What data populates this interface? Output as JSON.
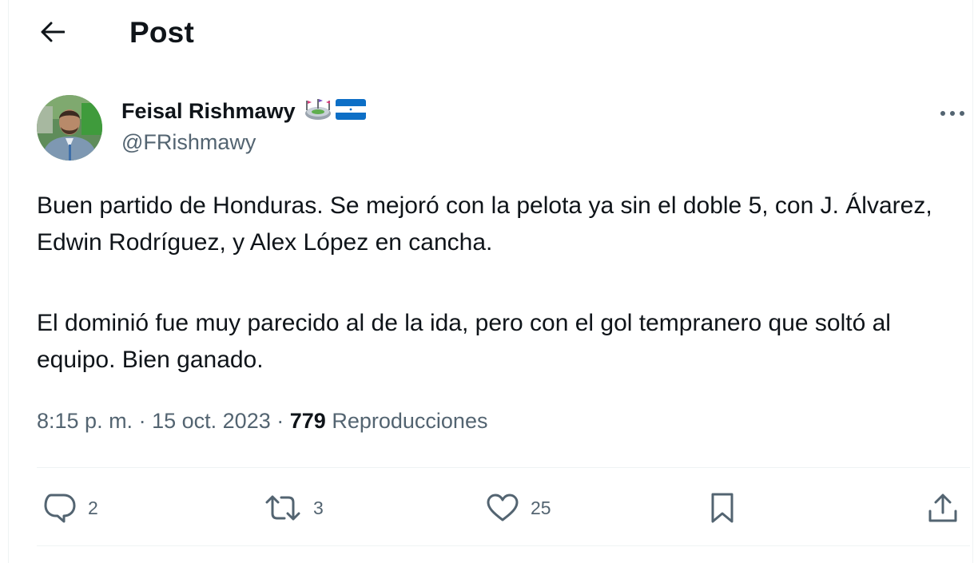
{
  "header": {
    "back_icon": "arrow-left-icon",
    "title": "Post"
  },
  "author": {
    "name": "Feisal Rishmawy",
    "handle": "@FRishmawy",
    "badges": [
      "stadium-emoji",
      "honduras-flag-emoji"
    ]
  },
  "tweet": {
    "paragraphs": [
      "Buen partido de Honduras. Se mejoró con la pelota ya sin el doble 5, con J. Álvarez, Edwin Rodríguez, y Alex López en cancha.",
      "El dominió fue muy parecido al de la ida, pero con el gol tempranero que soltó al equipo. Bien ganado."
    ]
  },
  "meta": {
    "time": "8:15 p. m.",
    "separator": "·",
    "date": "15 oct. 2023",
    "views_count": "779",
    "views_label": "Reproducciones"
  },
  "actions": {
    "replies": "2",
    "reposts": "3",
    "likes": "25"
  },
  "colors": {
    "text": "#0f1419",
    "secondary": "#536471",
    "divider": "#eff3f4"
  }
}
